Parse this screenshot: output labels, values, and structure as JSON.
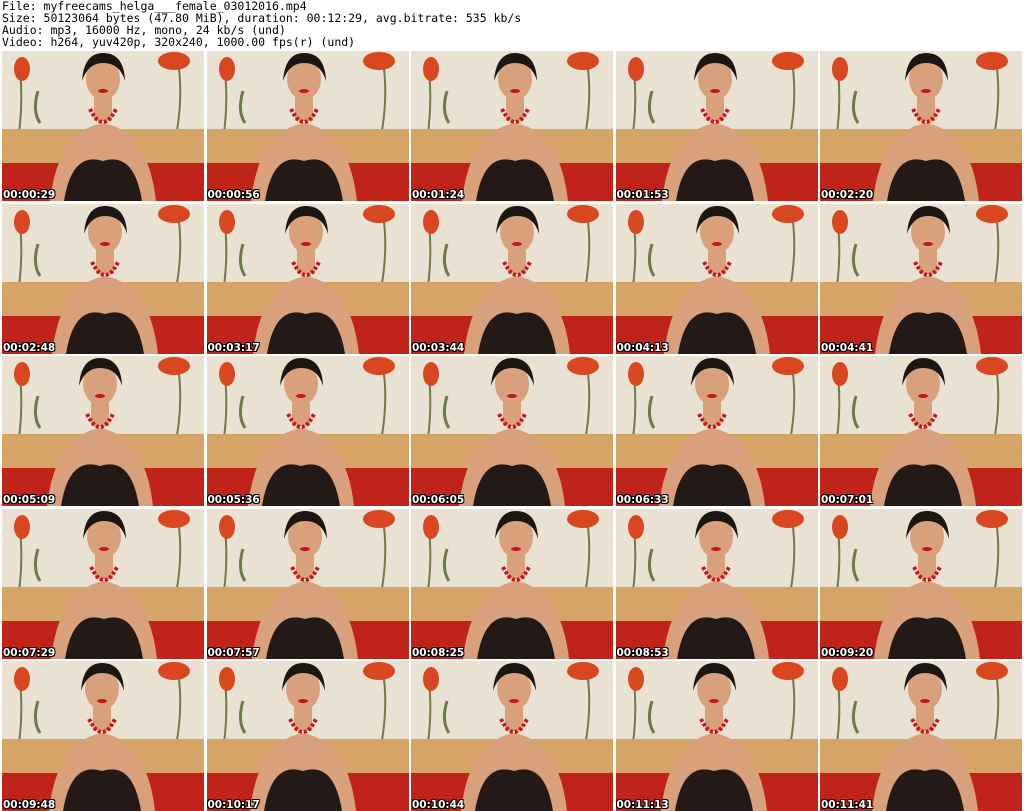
{
  "header": {
    "file_line": "File: myfreecams_helga___female_03012016.mp4",
    "size_line": "Size: 50123064 bytes (47.80 MiB), duration: 00:12:29, avg.bitrate: 535 kb/s",
    "audio_line": "Audio: mp3, 16000 Hz, mono, 24 kb/s (und)",
    "video_line": "Video: h264, yuv420p, 320x240, 1000.00 fps(r) (und)"
  },
  "thumbnails": [
    {
      "timestamp": "00:00:29"
    },
    {
      "timestamp": "00:00:56"
    },
    {
      "timestamp": "00:01:24"
    },
    {
      "timestamp": "00:01:53"
    },
    {
      "timestamp": "00:02:20"
    },
    {
      "timestamp": "00:02:48"
    },
    {
      "timestamp": "00:03:17"
    },
    {
      "timestamp": "00:03:44"
    },
    {
      "timestamp": "00:04:13"
    },
    {
      "timestamp": "00:04:41"
    },
    {
      "timestamp": "00:05:09"
    },
    {
      "timestamp": "00:05:36"
    },
    {
      "timestamp": "00:06:05"
    },
    {
      "timestamp": "00:06:33"
    },
    {
      "timestamp": "00:07:01"
    },
    {
      "timestamp": "00:07:29"
    },
    {
      "timestamp": "00:07:57"
    },
    {
      "timestamp": "00:08:25"
    },
    {
      "timestamp": "00:08:53"
    },
    {
      "timestamp": "00:09:20"
    },
    {
      "timestamp": "00:09:48"
    },
    {
      "timestamp": "00:10:17"
    },
    {
      "timestamp": "00:10:44"
    },
    {
      "timestamp": "00:11:13"
    },
    {
      "timestamp": "00:11:41"
    }
  ],
  "colors": {
    "wall": "#e9e2d3",
    "flower": "#d8471f",
    "stem": "#6f7a4a",
    "sofa": "#d6a466",
    "red_floor": "#c0231a",
    "hair": "#1c1612",
    "skin": "#d9a07c",
    "outfit": "#231a18",
    "necklace": "#c8141a"
  }
}
